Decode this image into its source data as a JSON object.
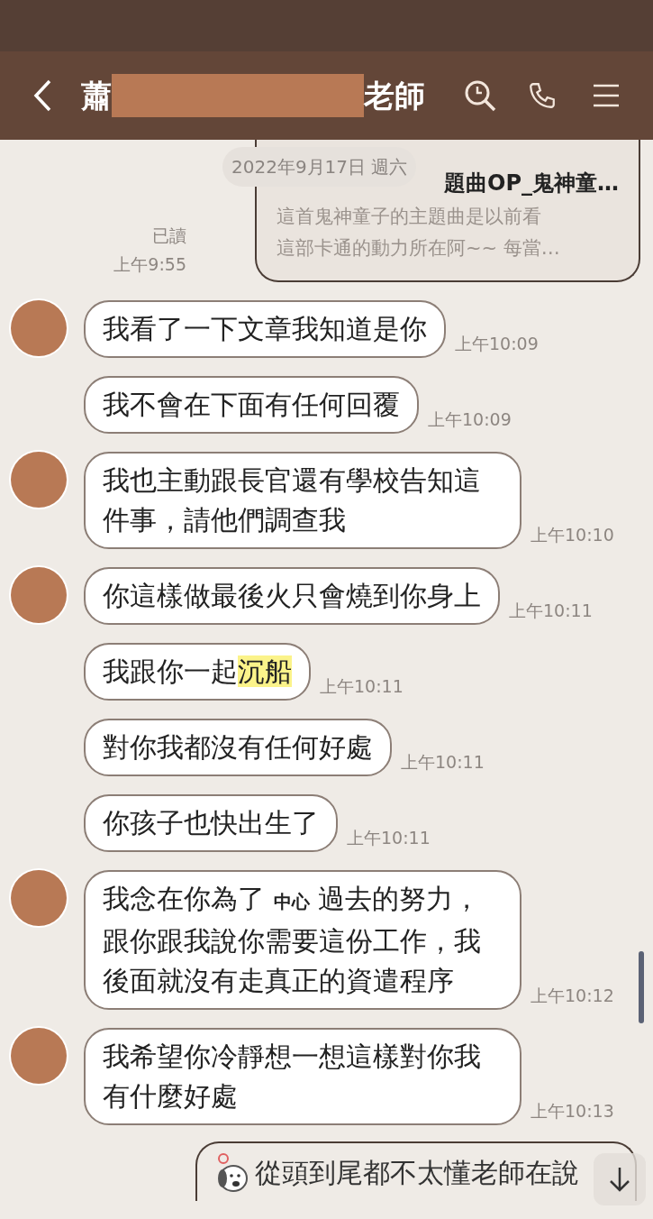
{
  "header": {
    "title_start": "蕭",
    "title_end": "老師"
  },
  "date_divider": "2022年9月17日 週六",
  "link_card": {
    "title": "題曲OP_鬼神童…",
    "description_lines": [
      "這首鬼神童子的主題曲是以前看",
      "這部卡通的動力所在阿~~ 每當…"
    ],
    "read_label": "已讀",
    "time": "上午9:55"
  },
  "messages": [
    {
      "avatar": true,
      "parts": [
        {
          "text": "我看了一下文章我知道是你"
        }
      ],
      "time": "上午10:09"
    },
    {
      "avatar": false,
      "parts": [
        {
          "text": "我不會在下面有任何回覆"
        }
      ],
      "time": "上午10:09"
    },
    {
      "avatar": true,
      "parts": [
        {
          "text": "我也主動跟長官還有學校告知這件事，請他們調查我"
        }
      ],
      "time": "上午10:10"
    },
    {
      "avatar": true,
      "parts": [
        {
          "text": "你這樣做最後火只會燒到你身上"
        }
      ],
      "time": "上午10:11"
    },
    {
      "avatar": false,
      "parts": [
        {
          "text": "我跟你一起"
        },
        {
          "text": "沉船",
          "kind": "highlight"
        }
      ],
      "time": "上午10:11"
    },
    {
      "avatar": false,
      "parts": [
        {
          "text": "對你我都沒有任何好處"
        }
      ],
      "time": "上午10:11"
    },
    {
      "avatar": false,
      "parts": [
        {
          "text": "你孩子也快出生了"
        }
      ],
      "time": "上午10:11"
    },
    {
      "avatar": true,
      "parts": [
        {
          "text": "我念在你為了 "
        },
        {
          "text": "中心",
          "kind": "inset"
        },
        {
          "text": " 過去的努力，跟你跟我說你需要這份工作，我後面就沒有走真正的資遣程序"
        }
      ],
      "time": "上午10:12"
    },
    {
      "avatar": true,
      "parts": [
        {
          "text": "我希望你冷靜想一想這樣對你我有什麼好處"
        }
      ],
      "time": "上午10:13"
    }
  ],
  "reply_preview": "從頭到尾都不太懂老師在說"
}
